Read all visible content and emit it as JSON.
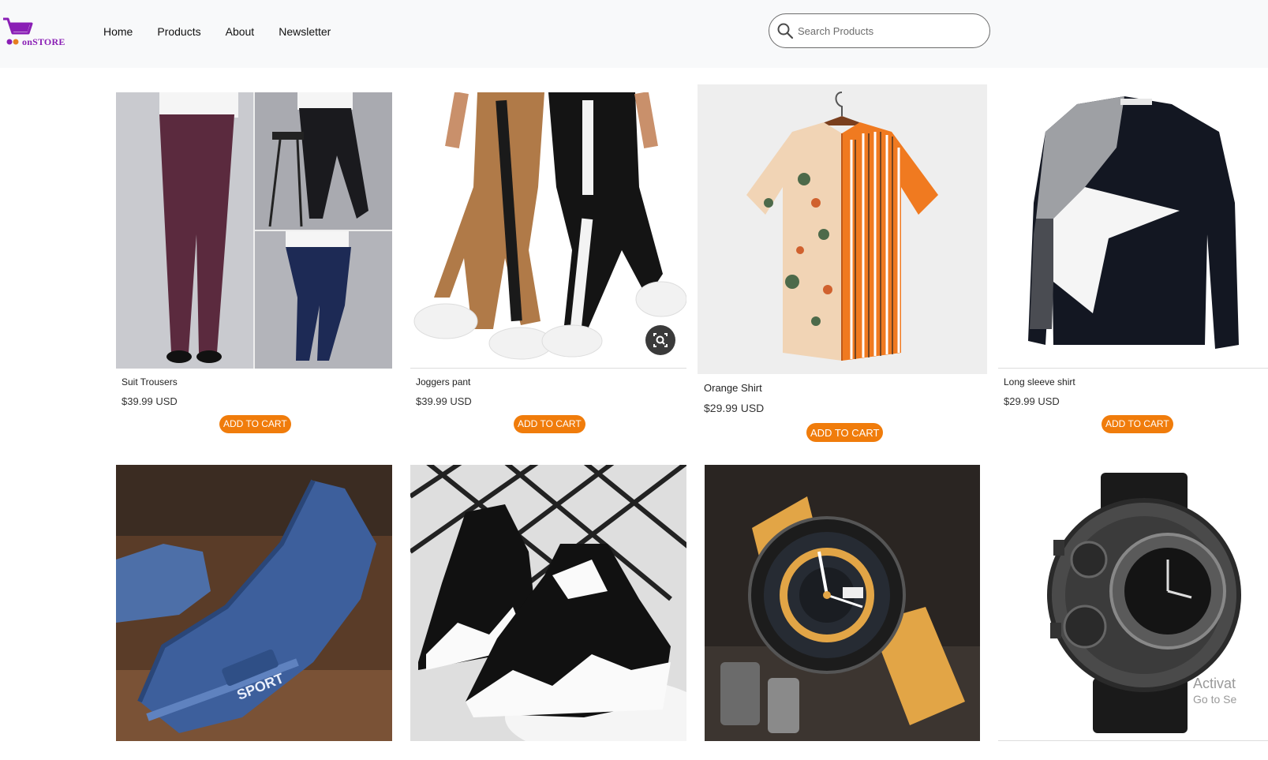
{
  "brand": {
    "name": "onSTORE"
  },
  "nav": {
    "items": [
      "Home",
      "Products",
      "About",
      "Newsletter"
    ]
  },
  "search": {
    "placeholder": "Search Products",
    "value": ""
  },
  "products": [
    {
      "name": "Suit Trousers",
      "price": "$39.99 USD",
      "button": "ADD TO CART"
    },
    {
      "name": "Joggers pant",
      "price": "$39.99 USD",
      "button": "ADD TO CART"
    },
    {
      "name": "Orange Shirt",
      "price": "$29.99 USD",
      "button": "ADD TO CART"
    },
    {
      "name": "Long sleeve shirt",
      "price": "$29.99 USD",
      "button": "ADD TO CART"
    }
  ],
  "watermark": {
    "line1": "Activat",
    "line2": "Go to Se"
  },
  "colors": {
    "accent": "#f07c0b",
    "brand": "#8a1fb5",
    "header_bg": "#f8f9fa"
  },
  "icons": [
    "cart-logo-icon",
    "search-icon",
    "lens-search-icon"
  ]
}
